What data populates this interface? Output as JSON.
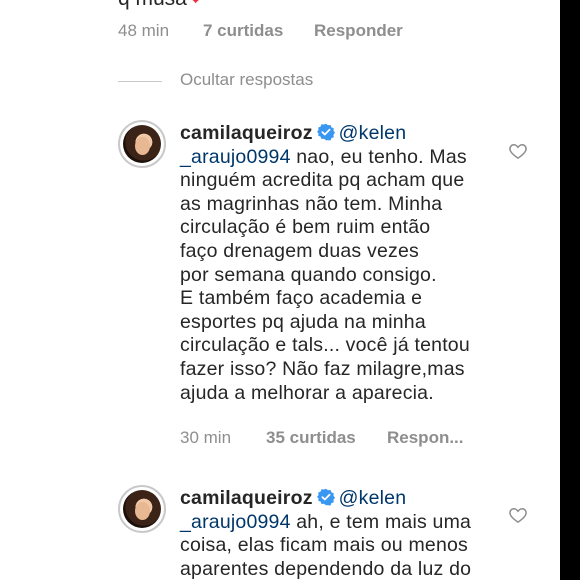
{
  "top_comment": {
    "text": "q músa",
    "time": "48 min",
    "likes": "7 curtidas",
    "reply": "Responder"
  },
  "hide_replies": "Ocultar respostas",
  "replies": [
    {
      "username": "camilaqueiroz",
      "mention_line1": "@kelen",
      "mention_line2": "_araujo0994",
      "text_first": " nao, eu tenho. Mas",
      "text_rest": "ninguém acredita pq acham que\nas magrinhas não tem. Minha\ncirculação é bem ruim então\nfaço drenagem duas vezes\npor semana quando consigo.\nE também faço academia e\nesportes pq ajuda na minha\ncirculação e tals... você já tentou\nfazer isso? Não faz milagre,mas\najuda a melhorar a aparecia.",
      "time": "30 min",
      "likes": "35 curtidas",
      "reply": "Respon..."
    },
    {
      "username": "camilaqueiroz",
      "mention_line1": "@kelen",
      "mention_line2": "_araujo0994",
      "text_first": " ah, e tem mais uma",
      "text_rest": "coisa, elas ficam mais ou menos\naparentes dependendo da luz do"
    }
  ],
  "colors": {
    "text": "#262626",
    "secondary": "#8e8e8e",
    "mention": "#00376b",
    "verified": "#3897f0",
    "heart": "#ed2b3c"
  }
}
